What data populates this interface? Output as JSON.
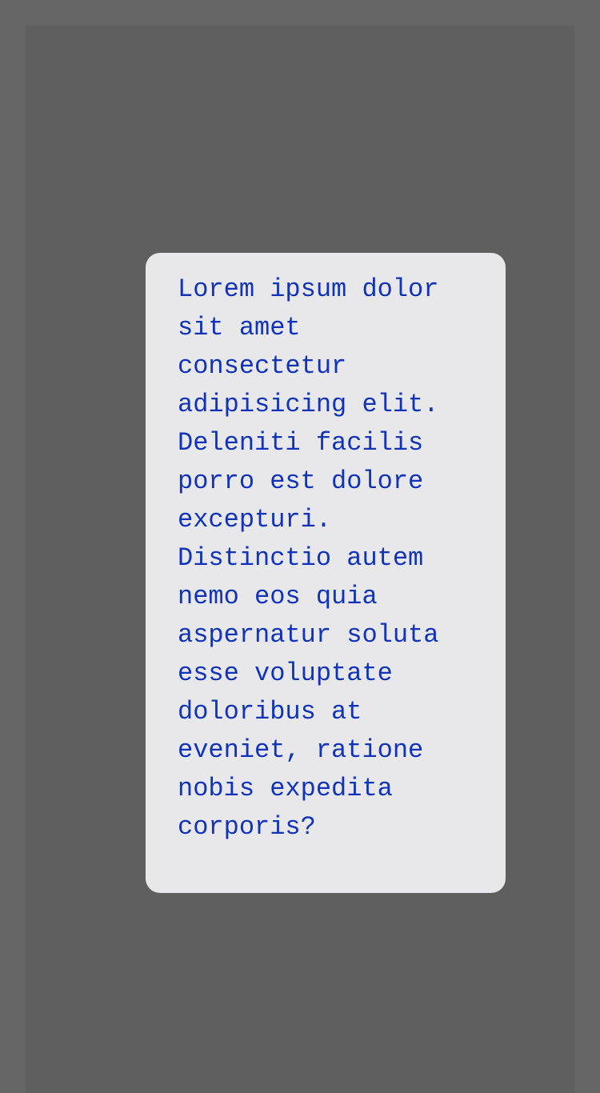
{
  "card": {
    "text": "Lorem ipsum dolor sit amet consectetur adipisicing elit. Deleniti facilis porro est dolore excepturi. Distinctio autem nemo eos quia aspernatur soluta esse voluptate doloribus at eveniet, ratione nobis expedita corporis?"
  },
  "colors": {
    "page_background": "#666666",
    "screen_background": "#5f5f5f",
    "card_background": "#e8e8ea",
    "text": "#1133bb"
  }
}
